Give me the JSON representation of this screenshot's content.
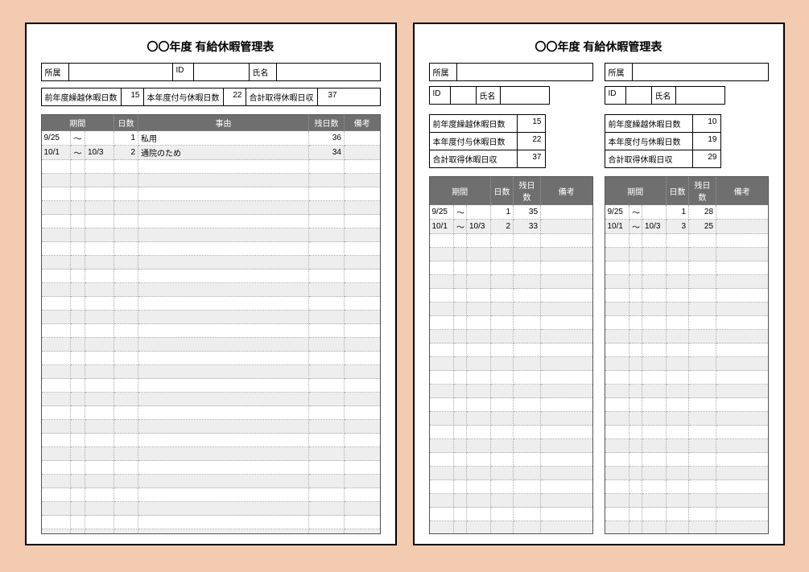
{
  "title": "〇〇年度  有給休暇管理表",
  "labels": {
    "dept": "所属",
    "id": "ID",
    "name": "氏名",
    "prev": "前年度繰越休暇日数",
    "curr": "本年度付与休暇日数",
    "total": "合計取得休暇日収",
    "period": "期間",
    "days": "日数",
    "reason": "事由",
    "remaining": "残日数",
    "remarks": "備考"
  },
  "page1": {
    "dept": "",
    "id": "",
    "name": "",
    "prev": 15,
    "curr": 22,
    "total": 37,
    "rows": [
      {
        "from": "9/25",
        "sep": "～",
        "to": "",
        "days": 1,
        "reason": "私用",
        "remaining": 36,
        "remarks": ""
      },
      {
        "from": "10/1",
        "sep": "～",
        "to": "10/3",
        "days": 2,
        "reason": "通院のため",
        "remaining": 34,
        "remarks": ""
      }
    ],
    "empty_rows": 28
  },
  "page2": {
    "left": {
      "dept": "",
      "id": "",
      "name": "",
      "prev": 15,
      "curr": 22,
      "total": 37,
      "rows": [
        {
          "from": "9/25",
          "sep": "～",
          "to": "",
          "days": 1,
          "remaining": 35,
          "remarks": ""
        },
        {
          "from": "10/1",
          "sep": "～",
          "to": "10/3",
          "days": 2,
          "remaining": 33,
          "remarks": ""
        }
      ],
      "empty_rows": 22
    },
    "right": {
      "dept": "",
      "id": "",
      "name": "",
      "prev": 10,
      "curr": 19,
      "total": 29,
      "rows": [
        {
          "from": "9/25",
          "sep": "～",
          "to": "",
          "days": 1,
          "remaining": 28,
          "remarks": ""
        },
        {
          "from": "10/1",
          "sep": "～",
          "to": "10/3",
          "days": 3,
          "remaining": 25,
          "remarks": ""
        }
      ],
      "empty_rows": 22
    }
  }
}
